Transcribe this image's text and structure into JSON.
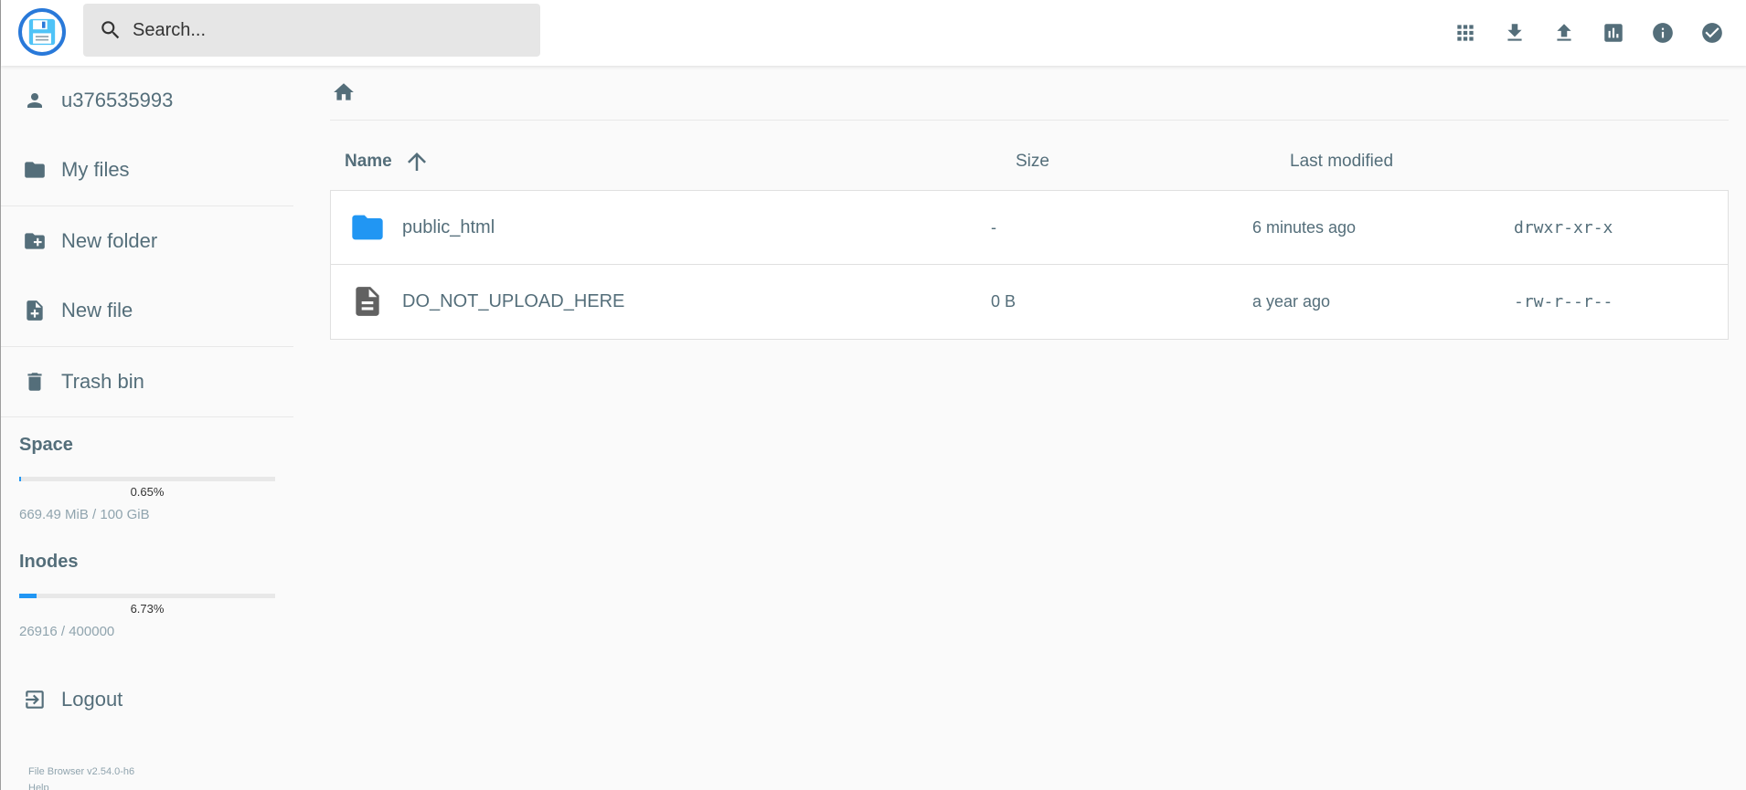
{
  "header": {
    "search_placeholder": "Search...",
    "actions": [
      {
        "icon": "grid-view-icon"
      },
      {
        "icon": "download-icon"
      },
      {
        "icon": "upload-icon"
      },
      {
        "icon": "bar-chart-icon"
      },
      {
        "icon": "info-icon"
      },
      {
        "icon": "check-circle-icon"
      }
    ]
  },
  "sidebar": {
    "user": "u376535993",
    "my_files": "My files",
    "new_folder": "New folder",
    "new_file": "New file",
    "trash_bin": "Trash bin",
    "space": {
      "title": "Space",
      "percent": 0.65,
      "percent_label": "0.65%",
      "usage": "669.49 MiB / 100 GiB"
    },
    "inodes": {
      "title": "Inodes",
      "percent": 6.73,
      "percent_label": "6.73%",
      "usage": "26916 / 400000"
    },
    "logout": "Logout",
    "version": "File Browser v2.54.0-h6",
    "help": "Help"
  },
  "list": {
    "columns": {
      "name": "Name",
      "size": "Size",
      "modified": "Last modified"
    },
    "rows": [
      {
        "type": "folder",
        "name": "public_html",
        "size": "-",
        "modified": "6 minutes ago",
        "perms": "drwxr-xr-x"
      },
      {
        "type": "file",
        "name": "DO_NOT_UPLOAD_HERE",
        "size": "0 B",
        "modified": "a year ago",
        "perms": "-rw-r--r--"
      }
    ]
  },
  "colors": {
    "accent": "#2196f3",
    "text": "#546e7a",
    "folder": "#2196f3",
    "file": "#616161"
  }
}
